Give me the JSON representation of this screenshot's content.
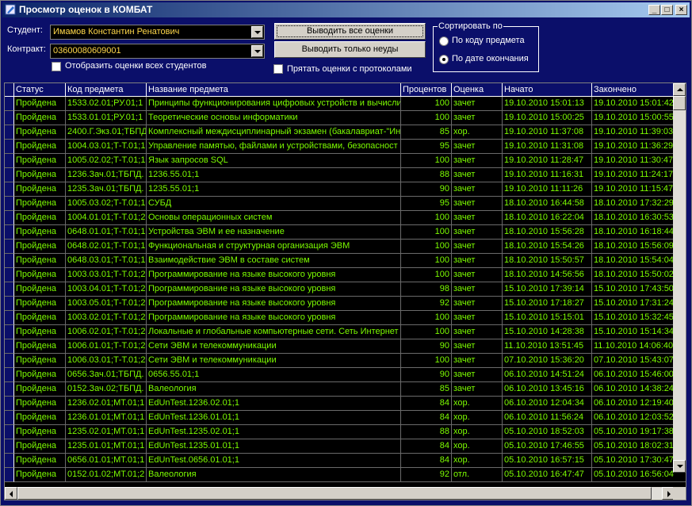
{
  "window": {
    "title": "Просмотр оценок в КОМБАТ",
    "icon": "app-icon",
    "min_glyph": "_",
    "max_glyph": "□",
    "close_glyph": "×"
  },
  "filters": {
    "student_label": "Студент:",
    "student_value": "Имамов Константин Ренатович",
    "contract_label": "Контракт:",
    "contract_value": "03600080609001",
    "show_all_students_label": "Отобразить оценки всех студентов",
    "show_all_students_checked": false,
    "hide_with_protocols_label": "Прятать оценки с протоколами",
    "hide_with_protocols_checked": false
  },
  "buttons": {
    "show_all": "Выводить все оценки",
    "show_failed": "Выводить только неуды"
  },
  "sort": {
    "legend": "Сортировать по",
    "by_code": "По коду предмета",
    "by_end_date": "По дате окончания",
    "selected": "by_end_date"
  },
  "table": {
    "columns": [
      "Статус",
      "Код предмета",
      "Название предмета",
      "Процентов",
      "Оценка",
      "Начато",
      "Закончено"
    ],
    "rows": [
      [
        "Пройдена",
        "1533.02.01;РУ.01;1",
        "Принципы функционирования цифровых устройств и вычисли",
        "100",
        "зачет",
        "19.10.2010 15:01:13",
        "19.10.2010 15:01:42"
      ],
      [
        "Пройдена",
        "1533.01.01;РУ.01;1",
        "Теоретические основы информатики",
        "100",
        "зачет",
        "19.10.2010 15:00:25",
        "19.10.2010 15:00:55"
      ],
      [
        "Пройдена",
        "2400.Г.Экз.01;ТБПД",
        "Комплексный междисциплинарный экзамен (бакалавриат-\"Ин",
        "85",
        "хор.",
        "19.10.2010 11:37:08",
        "19.10.2010 11:39:03"
      ],
      [
        "Пройдена",
        "1004.03.01;Т-Т.01;1",
        "Управление памятью, файлами и устройствами, безопасност",
        "95",
        "зачет",
        "19.10.2010 11:31:08",
        "19.10.2010 11:36:29"
      ],
      [
        "Пройдена",
        "1005.02.02;Т-Т.01;1",
        "Язык запросов SQL",
        "100",
        "зачет",
        "19.10.2010 11:28:47",
        "19.10.2010 11:30:47"
      ],
      [
        "Пройдена",
        "1236.Зач.01;ТБПД.",
        "1236.55.01;1",
        "88",
        "зачет",
        "19.10.2010 11:16:31",
        "19.10.2010 11:24:17"
      ],
      [
        "Пройдена",
        "1235.Зач.01;ТБПД.",
        "1235.55.01;1",
        "90",
        "зачет",
        "19.10.2010 11:11:26",
        "19.10.2010 11:15:47"
      ],
      [
        "Пройдена",
        "1005.03.02;Т-Т.01;1",
        "СУБД",
        "95",
        "зачет",
        "18.10.2010 16:44:58",
        "18.10.2010 17:32:29"
      ],
      [
        "Пройдена",
        "1004.01.01;Т-Т.01;2",
        "Основы операционных систем",
        "100",
        "зачет",
        "18.10.2010 16:22:04",
        "18.10.2010 16:30:53"
      ],
      [
        "Пройдена",
        "0648.01.01;Т-Т.01;1",
        "Устройства ЭВМ и ее назначение",
        "100",
        "зачет",
        "18.10.2010 15:56:28",
        "18.10.2010 16:18:44"
      ],
      [
        "Пройдена",
        "0648.02.01;Т-Т.01;1",
        "Функциональная и структурная организация ЭВМ",
        "100",
        "зачет",
        "18.10.2010 15:54:26",
        "18.10.2010 15:56:09"
      ],
      [
        "Пройдена",
        "0648.03.01;Т-Т.01;1",
        "Взаимодействие ЭВМ в составе систем",
        "100",
        "зачет",
        "18.10.2010 15:50:57",
        "18.10.2010 15:54:04"
      ],
      [
        "Пройдена",
        "1003.03.01;Т-Т.01;2",
        "Программирование на языке высокого уровня",
        "100",
        "зачет",
        "18.10.2010 14:56:56",
        "18.10.2010 15:50:02"
      ],
      [
        "Пройдена",
        "1003.04.01;Т-Т.01;2",
        "Программирование на языке высокого уровня",
        "98",
        "зачет",
        "15.10.2010 17:39:14",
        "15.10.2010 17:43:50"
      ],
      [
        "Пройдена",
        "1003.05.01;Т-Т.01;2",
        "Программирование на языке высокого уровня",
        "92",
        "зачет",
        "15.10.2010 17:18:27",
        "15.10.2010 17:31:24"
      ],
      [
        "Пройдена",
        "1003.02.01;Т-Т.01;2",
        "Программирование на языке высокого уровня",
        "100",
        "зачет",
        "15.10.2010 15:15:01",
        "15.10.2010 15:32:45"
      ],
      [
        "Пройдена",
        "1006.02.01;Т-Т.01;2",
        "Локальные и глобальные компьютерные сети. Сеть Интернет",
        "100",
        "зачет",
        "15.10.2010 14:28:38",
        "15.10.2010 15:14:34"
      ],
      [
        "Пройдена",
        "1006.01.01;Т-Т.01;2",
        "Сети ЭВМ и телекоммуникации",
        "90",
        "зачет",
        "11.10.2010 13:51:45",
        "11.10.2010 14:06:40"
      ],
      [
        "Пройдена",
        "1006.03.01;Т-Т.01;2",
        "Сети ЭВМ и телекоммуникации",
        "100",
        "зачет",
        "07.10.2010 15:36:20",
        "07.10.2010 15:43:07"
      ],
      [
        "Пройдена",
        "0656.Зач.01;ТБПД.",
        "0656.55.01;1",
        "90",
        "зачет",
        "06.10.2010 14:51:24",
        "06.10.2010 15:46:00"
      ],
      [
        "Пройдена",
        "0152.Зач.02;ТБПД.",
        "Валеология",
        "85",
        "зачет",
        "06.10.2010 13:45:16",
        "06.10.2010 14:38:24"
      ],
      [
        "Пройдена",
        "1236.02.01;МТ.01;1",
        "EdUnTest.1236.02.01;1",
        "84",
        "хор.",
        "06.10.2010 12:04:34",
        "06.10.2010 12:19:40"
      ],
      [
        "Пройдена",
        "1236.01.01;МТ.01;1",
        "EdUnTest.1236.01.01;1",
        "84",
        "хор.",
        "06.10.2010 11:56:24",
        "06.10.2010 12:03:52"
      ],
      [
        "Пройдена",
        "1235.02.01;МТ.01;1",
        "EdUnTest.1235.02.01;1",
        "88",
        "хор.",
        "05.10.2010 18:52:03",
        "05.10.2010 19:17:38"
      ],
      [
        "Пройдена",
        "1235.01.01;МТ.01;1",
        "EdUnTest.1235.01.01;1",
        "84",
        "хор.",
        "05.10.2010 17:46:55",
        "05.10.2010 18:02:31"
      ],
      [
        "Пройдена",
        "0656.01.01;МТ.01;1",
        "EdUnTest.0656.01.01;1",
        "84",
        "хор.",
        "05.10.2010 16:57:15",
        "05.10.2010 17:30:47"
      ],
      [
        "Пройдена",
        "0152.01.02;МТ.01;2",
        "Валеология",
        "92",
        "отл.",
        "05.10.2010 16:47:47",
        "05.10.2010 16:56:04"
      ]
    ]
  },
  "colors": {
    "background": "#0b0f6a",
    "grid_text": "#7cfc00",
    "combo_text": "#ffd84a"
  }
}
